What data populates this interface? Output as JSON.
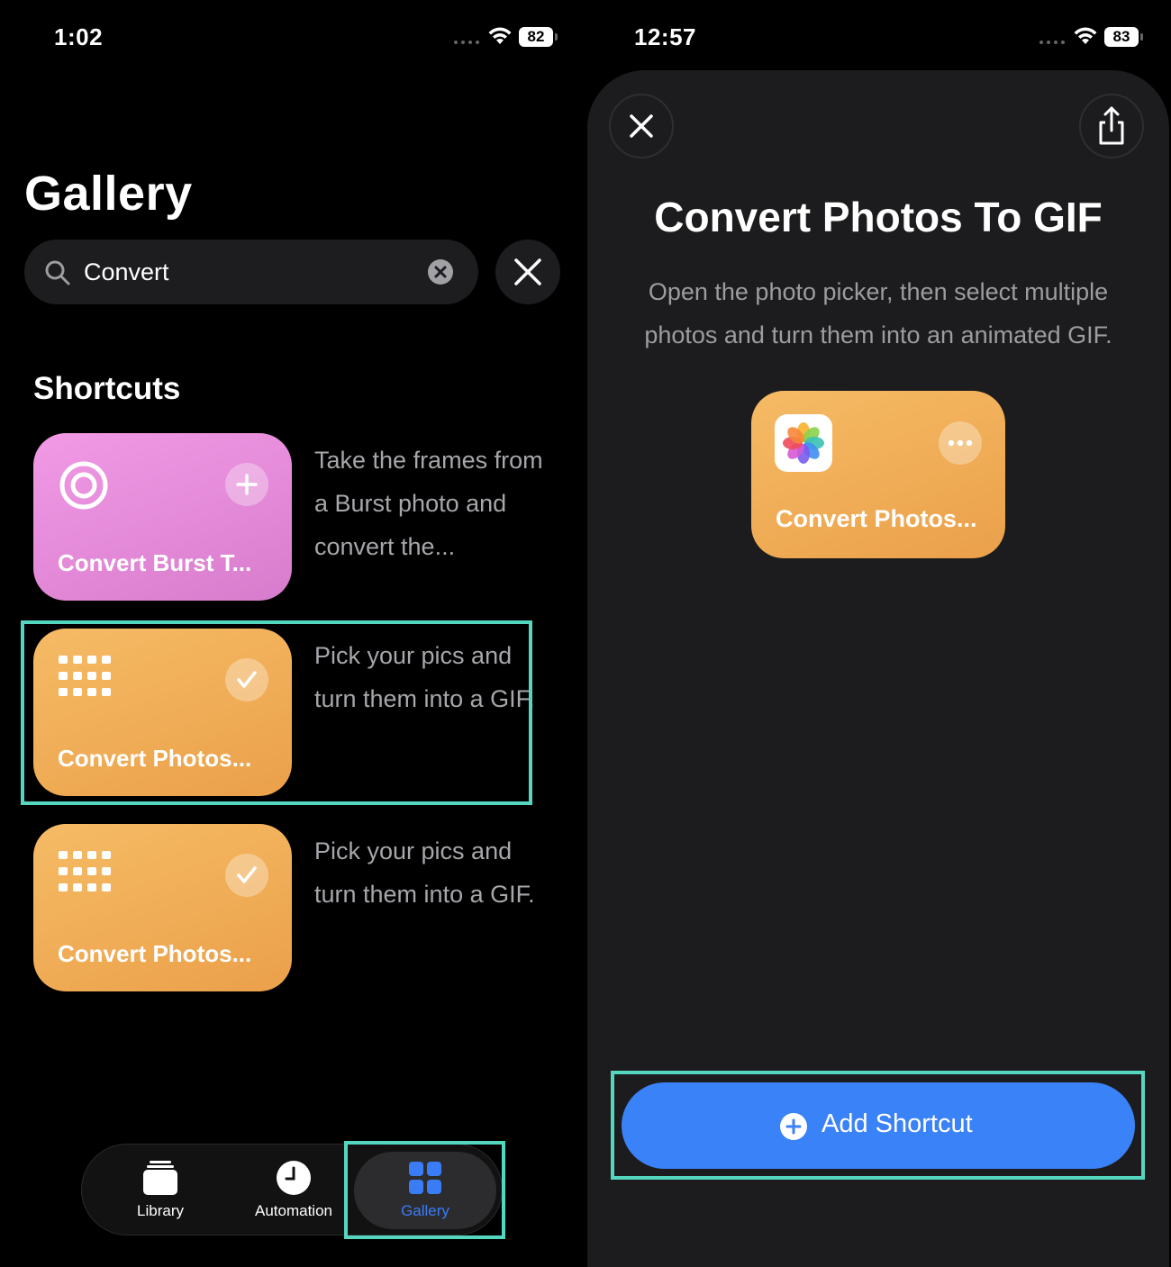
{
  "left": {
    "status": {
      "time": "1:02",
      "battery": "82"
    },
    "title": "Gallery",
    "search": {
      "value": "Convert"
    },
    "section_title": "Shortcuts",
    "shortcuts": [
      {
        "label": "Convert Burst T...",
        "description": "Take the frames from a Burst photo and convert the...",
        "color": "#e48ad9",
        "badge": "plus"
      },
      {
        "label": "Convert Photos...",
        "description": "Pick your pics and turn them into a GIF.",
        "color": "#efaa55",
        "badge": "check"
      },
      {
        "label": "Convert Photos...",
        "description": "Pick your pics and turn them into a GIF.",
        "color": "#efaa55",
        "badge": "check"
      }
    ],
    "tabs": [
      {
        "label": "Library",
        "icon": "library-icon"
      },
      {
        "label": "Automation",
        "icon": "clock-icon"
      },
      {
        "label": "Gallery",
        "icon": "gallery-grid-icon",
        "selected": true
      }
    ]
  },
  "right": {
    "status": {
      "time": "12:57",
      "battery": "83"
    },
    "title": "Convert Photos To GIF",
    "description": "Open the photo picker, then select multiple photos and turn them into an animated GIF.",
    "preview_card": {
      "label": "Convert Photos...",
      "icon": "photos-app-icon"
    },
    "add_button": {
      "label": "Add Shortcut"
    }
  },
  "colors": {
    "accent_blue": "#3a82f7",
    "highlight": "#55d6bf",
    "gallery_tab_text": "#3a7cf5"
  }
}
